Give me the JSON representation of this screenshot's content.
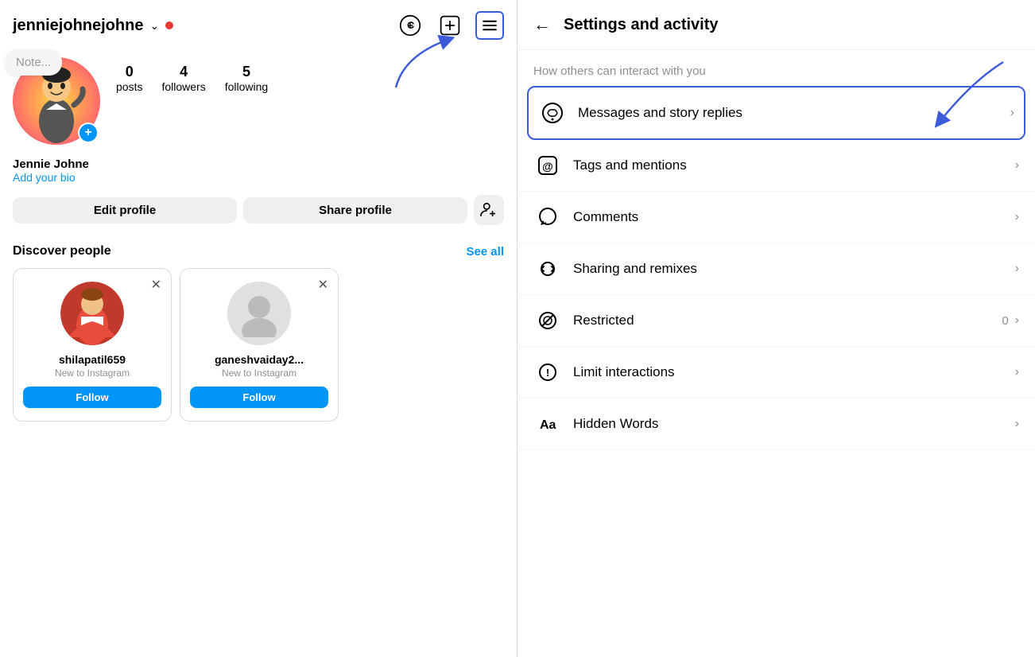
{
  "left": {
    "username": "jenniejohnejohne",
    "chevron": "∨",
    "note_placeholder": "Note...",
    "stats": [
      {
        "num": "0",
        "label": "posts"
      },
      {
        "num": "4",
        "label": "followers"
      },
      {
        "num": "5",
        "label": "following"
      }
    ],
    "display_name": "Jennie Johne",
    "bio_link": "Add your bio",
    "edit_btn": "Edit profile",
    "share_btn": "Share profile",
    "discover_title": "Discover people",
    "see_all": "See all",
    "people": [
      {
        "name": "shilapatil659",
        "sub": "New to Instagram",
        "type": "photo"
      },
      {
        "name": "ganeshvaiday2...",
        "sub": "New to Instagram",
        "type": "placeholder"
      }
    ],
    "follow_btn": "Follow"
  },
  "right": {
    "back_label": "←",
    "title": "Settings and activity",
    "subtitle": "How others can interact with you",
    "items": [
      {
        "id": "messages",
        "label": "Messages and story replies",
        "badge": "",
        "highlighted": true
      },
      {
        "id": "tags",
        "label": "Tags and mentions",
        "badge": ""
      },
      {
        "id": "comments",
        "label": "Comments",
        "badge": ""
      },
      {
        "id": "sharing",
        "label": "Sharing and remixes",
        "badge": ""
      },
      {
        "id": "restricted",
        "label": "Restricted",
        "badge": "0"
      },
      {
        "id": "limit",
        "label": "Limit interactions",
        "badge": ""
      },
      {
        "id": "hidden",
        "label": "Hidden Words",
        "badge": ""
      }
    ]
  }
}
